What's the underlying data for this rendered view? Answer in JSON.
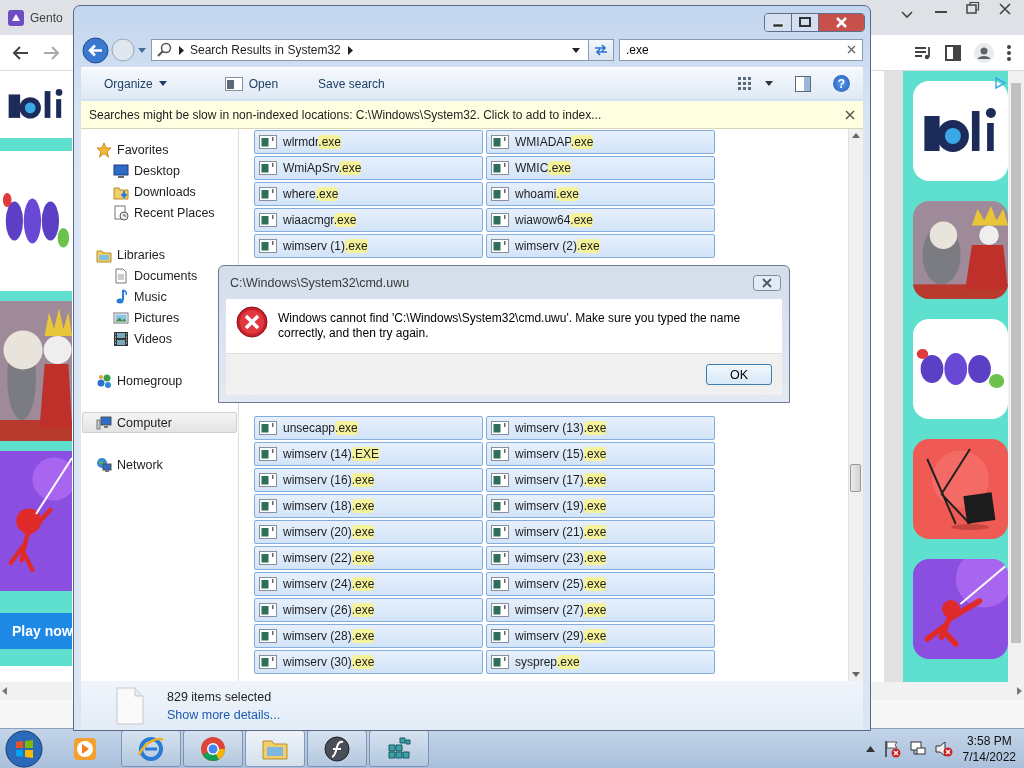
{
  "browser": {
    "tab_title": "Gento",
    "ad_button": "Play now"
  },
  "explorer": {
    "address": "Search Results in System32",
    "search": {
      "value": ".exe"
    },
    "toolbar": [
      {
        "label": "Organize",
        "kind": "menu"
      },
      {
        "label": "Open",
        "kind": "open"
      },
      {
        "label": "Save search",
        "kind": "plain"
      }
    ],
    "help": "?",
    "info_bar": "Searches might be slow in non-indexed locations: C:\\Windows\\System32. Click to add to index...",
    "nav": [
      {
        "label": "Favorites",
        "selected": false,
        "children": [
          {
            "label": "Desktop",
            "selected": false
          },
          {
            "label": "Downloads",
            "selected": false
          },
          {
            "label": "Recent Places",
            "selected": false
          }
        ]
      },
      {
        "label": "Libraries",
        "selected": false,
        "children": [
          {
            "label": "Documents",
            "selected": false
          },
          {
            "label": "Music",
            "selected": false
          },
          {
            "label": "Pictures",
            "selected": false
          },
          {
            "label": "Videos",
            "selected": false
          }
        ]
      },
      {
        "label": "Homegroup",
        "selected": false
      },
      {
        "label": "Computer",
        "selected": true
      },
      {
        "label": "Network",
        "selected": false
      }
    ],
    "files_top": [
      {
        "name": "wlrmdr",
        "match": ".exe",
        "selected": true
      },
      {
        "name": "WMIADAP",
        "match": ".exe",
        "selected": true
      },
      {
        "name": "WmiApSrv",
        "match": ".exe",
        "selected": true
      },
      {
        "name": "WMIC",
        "match": ".exe",
        "selected": true
      },
      {
        "name": "where",
        "match": ".exe",
        "selected": true
      },
      {
        "name": "whoami",
        "match": ".exe",
        "selected": true
      },
      {
        "name": "wiaacmgr",
        "match": ".exe",
        "selected": true
      },
      {
        "name": "wiawow64",
        "match": ".exe",
        "selected": true
      },
      {
        "name": "wimserv (1)",
        "match": ".exe",
        "selected": true
      },
      {
        "name": "wimserv (2)",
        "match": ".exe",
        "selected": true
      }
    ],
    "files_bottom": [
      {
        "name": "unsecapp",
        "match": ".exe",
        "selected": true
      },
      {
        "name": "wimserv (13)",
        "match": ".exe",
        "selected": true
      },
      {
        "name": "wimserv (14)",
        "match": ".EXE",
        "selected": true
      },
      {
        "name": "wimserv (15)",
        "match": ".exe",
        "selected": true
      },
      {
        "name": "wimserv (16)",
        "match": ".exe",
        "selected": true
      },
      {
        "name": "wimserv (17)",
        "match": ".exe",
        "selected": true
      },
      {
        "name": "wimserv (18)",
        "match": ".exe",
        "selected": true
      },
      {
        "name": "wimserv (19)",
        "match": ".exe",
        "selected": true
      },
      {
        "name": "wimserv (20)",
        "match": ".exe",
        "selected": true
      },
      {
        "name": "wimserv (21)",
        "match": ".exe",
        "selected": true
      },
      {
        "name": "wimserv (22)",
        "match": ".exe",
        "selected": true
      },
      {
        "name": "wimserv (23)",
        "match": ".exe",
        "selected": true
      },
      {
        "name": "wimserv (24)",
        "match": ".exe",
        "selected": true
      },
      {
        "name": "wimserv (25)",
        "match": ".exe",
        "selected": true
      },
      {
        "name": "wimserv (26)",
        "match": ".exe",
        "selected": true
      },
      {
        "name": "wimserv (27)",
        "match": ".exe",
        "selected": true
      },
      {
        "name": "wimserv (28)",
        "match": ".exe",
        "selected": true
      },
      {
        "name": "wimserv (29)",
        "match": ".exe",
        "selected": true
      },
      {
        "name": "wimserv (30)",
        "match": ".exe",
        "selected": true
      },
      {
        "name": "sysprep",
        "match": ".exe",
        "selected": true
      }
    ],
    "details": {
      "count": "829 items selected",
      "link": "Show more details..."
    }
  },
  "dialog": {
    "title": "C:\\Windows\\System32\\cmd.uwu",
    "message": "Windows cannot find 'C:\\Windows\\System32\\cmd.uwu'. Make sure you typed the name correctly, and then try again.",
    "button": "OK"
  },
  "taskbar": {
    "apps": [
      {
        "kind": "player",
        "running": false,
        "selected": false
      },
      {
        "kind": "globe",
        "running": true,
        "selected": false
      },
      {
        "kind": "ring",
        "running": true,
        "selected": false
      },
      {
        "kind": "folder",
        "running": true,
        "selected": true
      },
      {
        "kind": "swirl",
        "running": true,
        "selected": false
      },
      {
        "kind": "cubes",
        "running": true,
        "selected": false
      }
    ],
    "time": "3:58 PM",
    "date": "7/14/2022"
  }
}
